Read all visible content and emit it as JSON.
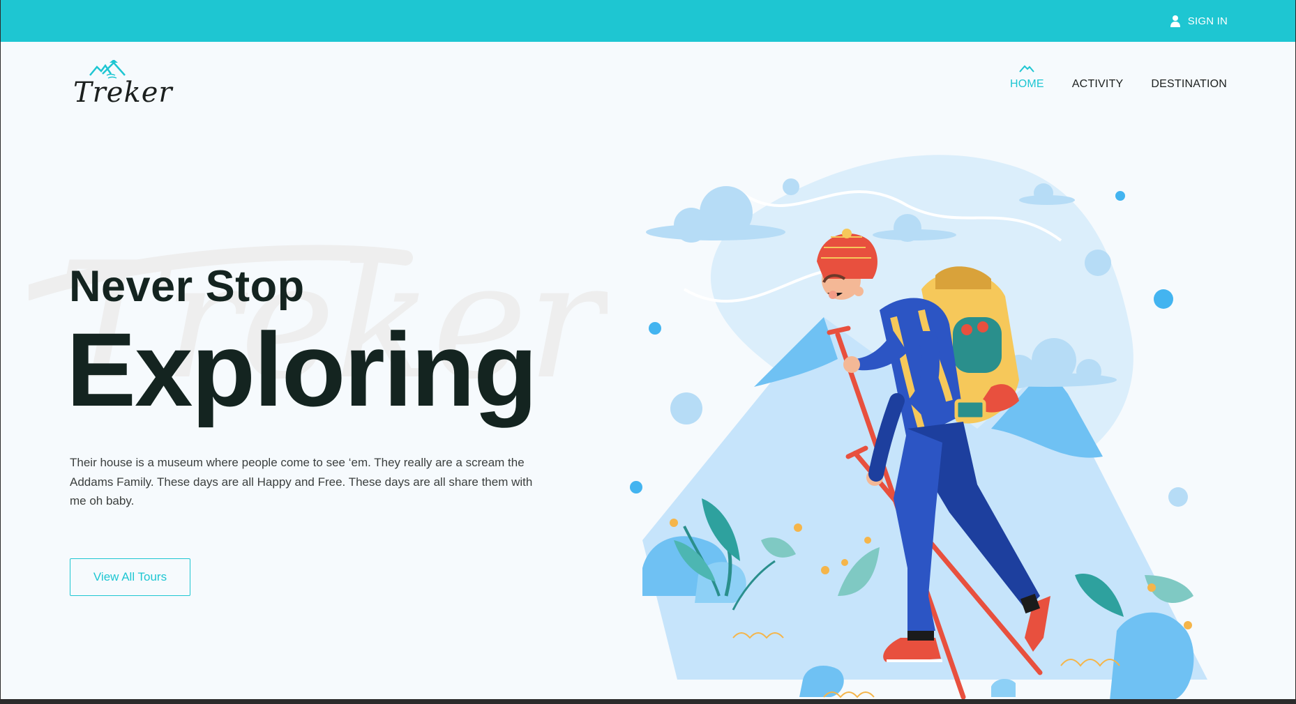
{
  "topbar": {
    "signin_label": "SIGN IN",
    "signin_icon": "user-icon",
    "color": "#1ec6d2"
  },
  "logo": {
    "text": "Treker",
    "icon": "mountain-logo-icon"
  },
  "nav": {
    "items": [
      {
        "label": "HOME",
        "active": true
      },
      {
        "label": "ACTIVITY",
        "active": false
      },
      {
        "label": "DESTINATION",
        "active": false
      }
    ]
  },
  "hero": {
    "watermark": "Treker",
    "title_small": "Never Stop",
    "title_big": "Exploring",
    "description": "Their house is a museum where people come to see ‘em. They really are a scream the Addams Family. These days are all Happy and Free. These days are all share them with me oh baby.",
    "cta_label": "View All Tours",
    "illustration": "hiker-illustration"
  },
  "colors": {
    "accent": "#1ec6d2",
    "heading": "#142420",
    "background": "#f6fafd"
  }
}
